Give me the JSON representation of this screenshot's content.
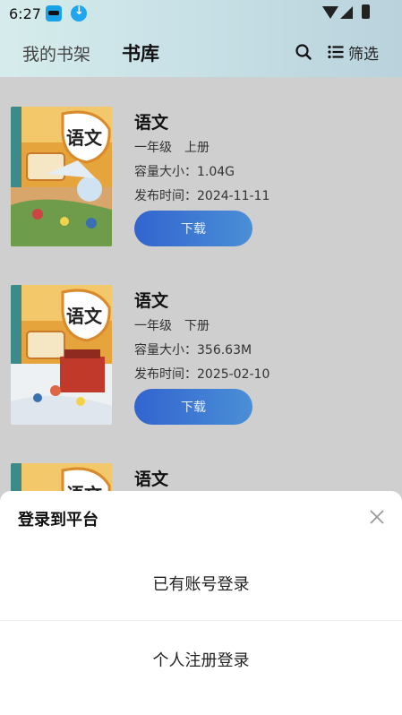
{
  "status_bar": {
    "time": "6:27"
  },
  "nav": {
    "tab_shelf": "我的书架",
    "tab_library": "书库",
    "filter_label": "筛选"
  },
  "books": [
    {
      "title": "语文",
      "grade": "一年级　上册",
      "size": "容量大小：1.04G",
      "date": "发布时间：2024-11-11",
      "download_label": "下载"
    },
    {
      "title": "语文",
      "grade": "一年级　下册",
      "size": "容量大小：356.63M",
      "date": "发布时间：2025-02-10",
      "download_label": "下载"
    },
    {
      "title": "语文"
    }
  ],
  "login_sheet": {
    "title": "登录到平台",
    "option_existing": "已有账号登录",
    "option_register": "个人注册登录"
  },
  "colors": {
    "accent_button": "#3b72d2",
    "overlay": "#cfcfcf"
  }
}
